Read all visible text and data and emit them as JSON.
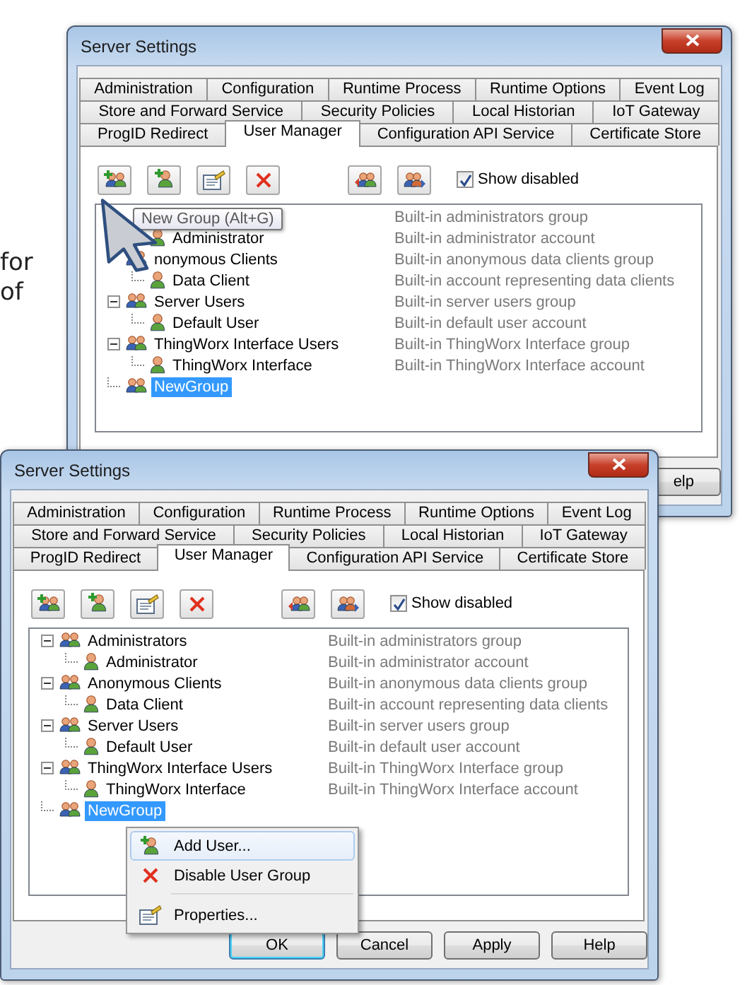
{
  "page_text": [
    "for",
    "of"
  ],
  "windows": [
    {
      "title": "Server Settings",
      "tab_rows": [
        [
          {
            "label": "Administration",
            "selected": false
          },
          {
            "label": "Configuration",
            "selected": false
          },
          {
            "label": "Runtime Process",
            "selected": false
          },
          {
            "label": "Runtime Options",
            "selected": false
          },
          {
            "label": "Event Log",
            "selected": false
          }
        ],
        [
          {
            "label": "Store and Forward Service",
            "selected": false
          },
          {
            "label": "Security Policies",
            "selected": false
          },
          {
            "label": "Local Historian",
            "selected": false
          },
          {
            "label": "IoT Gateway",
            "selected": false
          }
        ],
        [
          {
            "label": "ProgID Redirect",
            "selected": false
          },
          {
            "label": "User Manager",
            "selected": true
          },
          {
            "label": "Configuration API Service",
            "selected": false
          },
          {
            "label": "Certificate Store",
            "selected": false
          }
        ]
      ],
      "toolbar": {
        "left_buttons": [
          {
            "kind": "add-group"
          },
          {
            "kind": "add-user"
          },
          {
            "kind": "properties"
          },
          {
            "kind": "delete"
          }
        ],
        "right_buttons": [
          {
            "kind": "import"
          },
          {
            "kind": "export"
          }
        ],
        "show_disabled": {
          "label": "Show disabled",
          "checked": true
        }
      },
      "tree": [
        {
          "kind": "group",
          "description": "Built-in administrators group",
          "children": [
            {
              "kind": "user",
              "name": "Administrator",
              "description": "Built-in administrator account",
              "selected": false
            }
          ]
        },
        {
          "kind": "group",
          "name": "nonymous Clients",
          "description": "Built-in anonymous data clients group",
          "selected": false,
          "children": [
            {
              "kind": "user",
              "name": "Data Client",
              "description": "Built-in account representing data clients",
              "selected": false
            }
          ]
        },
        {
          "kind": "group",
          "name": "Server Users",
          "description": "Built-in server users group",
          "expanded": true,
          "selected": false,
          "children": [
            {
              "kind": "user",
              "name": "Default User",
              "description": "Built-in default user account",
              "selected": false
            }
          ]
        },
        {
          "kind": "group",
          "name": "ThingWorx Interface Users",
          "description": "Built-in ThingWorx Interface group",
          "expanded": true,
          "selected": false,
          "children": [
            {
              "kind": "user",
              "name": "ThingWorx Interface",
              "description": "Built-in ThingWorx Interface account",
              "selected": false
            }
          ]
        },
        {
          "kind": "group",
          "name": "NewGroup",
          "selected": true
        }
      ],
      "tooltip": "New Group (Alt+G)",
      "buttons": [
        {
          "label": "elp",
          "default": false
        }
      ]
    },
    {
      "title": "Server Settings",
      "tab_rows": [
        [
          {
            "label": "Administration",
            "selected": false
          },
          {
            "label": "Configuration",
            "selected": false
          },
          {
            "label": "Runtime Process",
            "selected": false
          },
          {
            "label": "Runtime Options",
            "selected": false
          },
          {
            "label": "Event Log",
            "selected": false
          }
        ],
        [
          {
            "label": "Store and Forward Service",
            "selected": false
          },
          {
            "label": "Security Policies",
            "selected": false
          },
          {
            "label": "Local Historian",
            "selected": false
          },
          {
            "label": "IoT Gateway",
            "selected": false
          }
        ],
        [
          {
            "label": "ProgID Redirect",
            "selected": false
          },
          {
            "label": "User Manager",
            "selected": true
          },
          {
            "label": "Configuration API Service",
            "selected": false
          },
          {
            "label": "Certificate Store",
            "selected": false
          }
        ]
      ],
      "toolbar": {
        "left_buttons": [
          {
            "kind": "add-group"
          },
          {
            "kind": "add-user"
          },
          {
            "kind": "properties"
          },
          {
            "kind": "delete"
          }
        ],
        "right_buttons": [
          {
            "kind": "import"
          },
          {
            "kind": "export"
          }
        ],
        "show_disabled": {
          "label": "Show disabled",
          "checked": true
        }
      },
      "tree": [
        {
          "kind": "group",
          "name": "Administrators",
          "description": "Built-in administrators group",
          "expanded": true,
          "selected": false,
          "children": [
            {
              "kind": "user",
              "name": "Administrator",
              "description": "Built-in administrator account",
              "selected": false
            }
          ]
        },
        {
          "kind": "group",
          "name": "Anonymous Clients",
          "description": "Built-in anonymous data clients group",
          "expanded": true,
          "selected": false,
          "children": [
            {
              "kind": "user",
              "name": "Data Client",
              "description": "Built-in account representing data clients",
              "selected": false
            }
          ]
        },
        {
          "kind": "group",
          "name": "Server Users",
          "description": "Built-in server users group",
          "expanded": true,
          "selected": false,
          "children": [
            {
              "kind": "user",
              "name": "Default User",
              "description": "Built-in default user account",
              "selected": false
            }
          ]
        },
        {
          "kind": "group",
          "name": "ThingWorx Interface Users",
          "description": "Built-in ThingWorx Interface group",
          "expanded": true,
          "selected": false,
          "children": [
            {
              "kind": "user",
              "name": "ThingWorx Interface",
              "description": "Built-in ThingWorx Interface account",
              "selected": false
            }
          ]
        },
        {
          "kind": "group",
          "name": "NewGroup",
          "selected": true
        }
      ],
      "context_menu": [
        {
          "kind": "add-user",
          "label": "Add User...",
          "selected": true,
          "separator_after": false
        },
        {
          "kind": "delete",
          "label": "Disable User Group",
          "selected": false,
          "separator_after": true
        },
        {
          "kind": "properties",
          "label": "Properties...",
          "selected": false,
          "separator_after": false
        }
      ],
      "buttons": [
        {
          "label": "OK",
          "default": true
        },
        {
          "label": "Cancel",
          "default": false
        },
        {
          "label": "Apply",
          "default": false
        },
        {
          "label": "Help",
          "default": false
        }
      ]
    }
  ]
}
